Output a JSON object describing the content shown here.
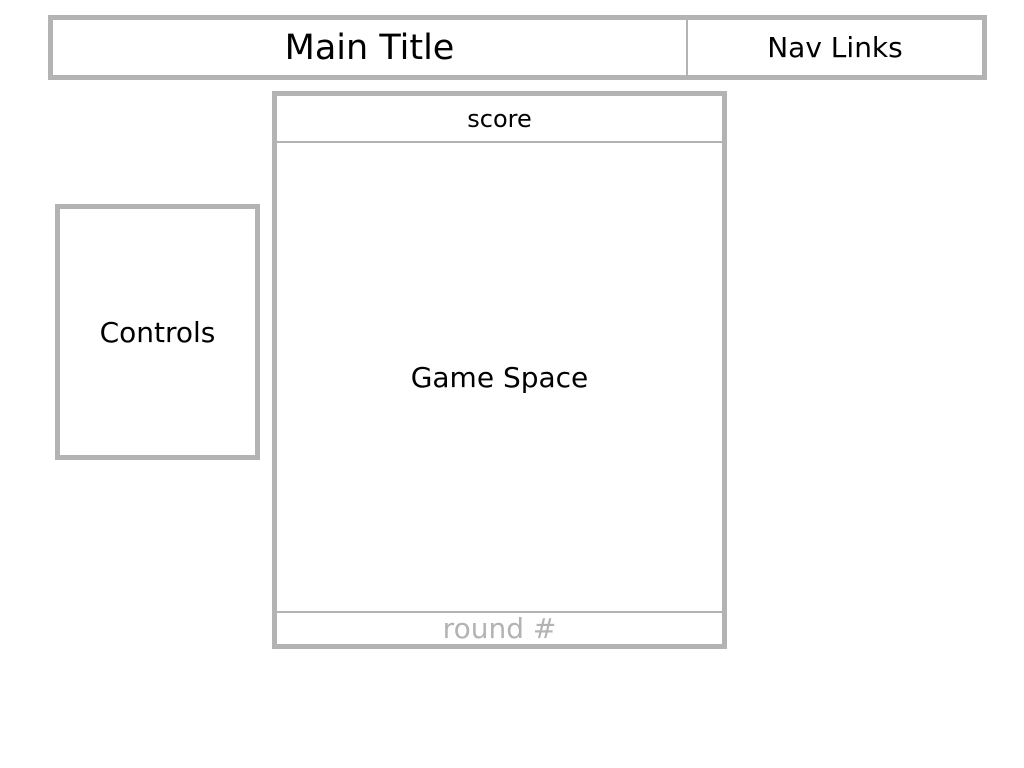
{
  "header": {
    "title": "Main Title",
    "nav_label": "Nav Links"
  },
  "controls": {
    "label": "Controls"
  },
  "game": {
    "score_label": "score",
    "space_label": "Game Space",
    "round_label": "round #"
  },
  "colors": {
    "border": "#b3b3b3",
    "text": "#000000",
    "muted_text": "#b3b3b3",
    "background": "#ffffff"
  }
}
